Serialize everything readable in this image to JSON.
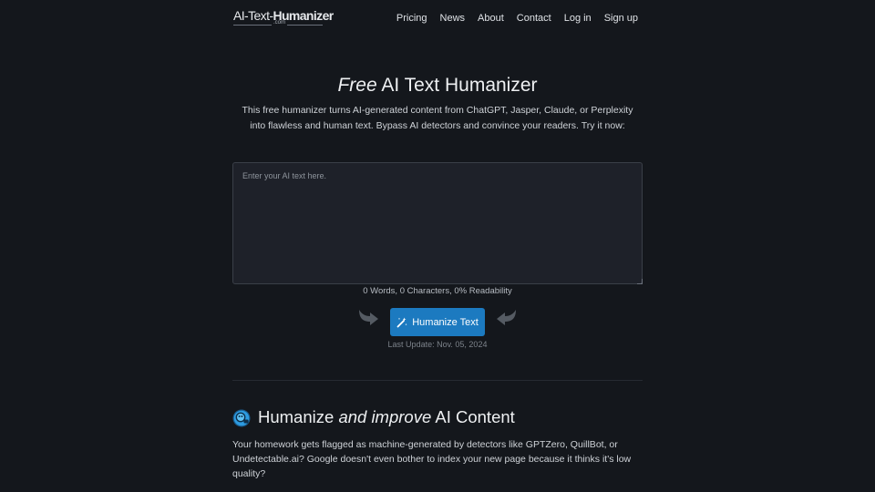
{
  "logo": {
    "part1": "AI-Text-",
    "part2": "Humanizer",
    "sub": ".com"
  },
  "nav": {
    "items": [
      "Pricing",
      "News",
      "About",
      "Contact",
      "Log in",
      "Sign up"
    ]
  },
  "hero": {
    "title_em": "Free",
    "title_rest": " AI Text Humanizer",
    "description": "This free humanizer turns AI-generated content from ChatGPT, Jasper, Claude, or Perplexity into flawless and human text. Bypass AI detectors and convince your readers. Try it now:"
  },
  "input": {
    "placeholder": "Enter your AI text here.",
    "value": ""
  },
  "stats": {
    "text": "0 Words, 0 Characters, 0% Readability"
  },
  "button": {
    "label": "Humanize Text",
    "color": "#1c7ac0"
  },
  "last_update": "Last Update: Nov. 05, 2024",
  "section": {
    "title_a": "Humanize ",
    "title_em": "and improve",
    "title_b": " AI Content",
    "body": "Your homework gets flagged as machine-generated by detectors like GPTZero, QuillBot, or Undetectable.ai? Google doesn't even bother to index your new page because it thinks it's low quality?"
  },
  "icons": {
    "logo": "logo",
    "magic": "magic-wand-icon",
    "arrow_left": "curved-arrow-right-icon",
    "arrow_right": "curved-arrow-left-icon",
    "section": "robot-head-icon"
  }
}
